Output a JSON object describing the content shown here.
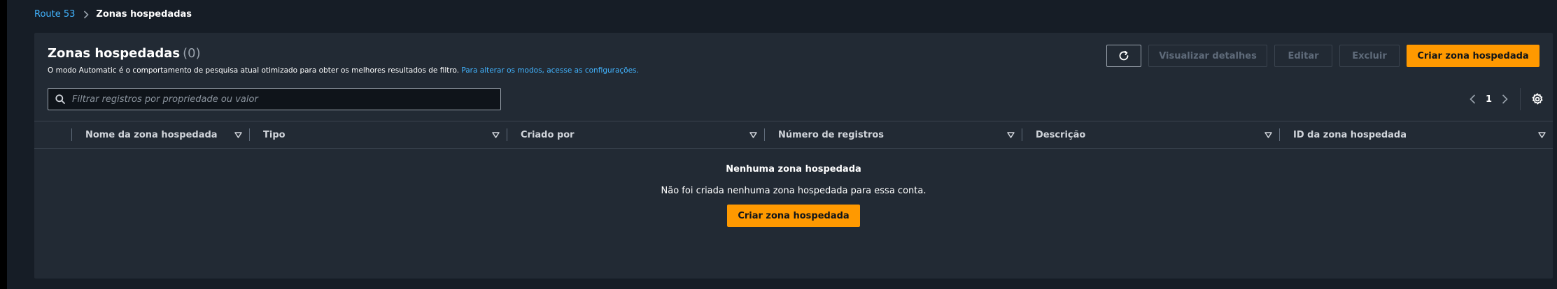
{
  "breadcrumb": {
    "root": "Route 53",
    "current": "Zonas hospedadas"
  },
  "panel": {
    "title": "Zonas hospedadas",
    "count": "(0)",
    "description": "O modo Automatic é o comportamento de pesquisa atual otimizado para obter os melhores resultados de filtro.",
    "description_link": "Para alterar os modos, acesse as configurações."
  },
  "toolbar": {
    "refresh_icon": "refresh-icon",
    "view_details": "Visualizar detalhes",
    "edit": "Editar",
    "delete": "Excluir",
    "create": "Criar zona hospedada"
  },
  "search": {
    "placeholder": "Filtrar registros por propriedade ou valor",
    "value": ""
  },
  "pagination": {
    "current_page": "1"
  },
  "table": {
    "columns": [
      "Nome da zona hospedada",
      "Tipo",
      "Criado por",
      "Número de registros",
      "Descrição",
      "ID da zona hospedada"
    ]
  },
  "empty_state": {
    "title": "Nenhuma zona hospedada",
    "description": "Não foi criada nenhuma zona hospedada para essa conta.",
    "button": "Criar zona hospedada"
  },
  "colors": {
    "accent": "#ff9900",
    "link": "#42b4ff",
    "panel": "#222a34",
    "background": "#161d26"
  }
}
